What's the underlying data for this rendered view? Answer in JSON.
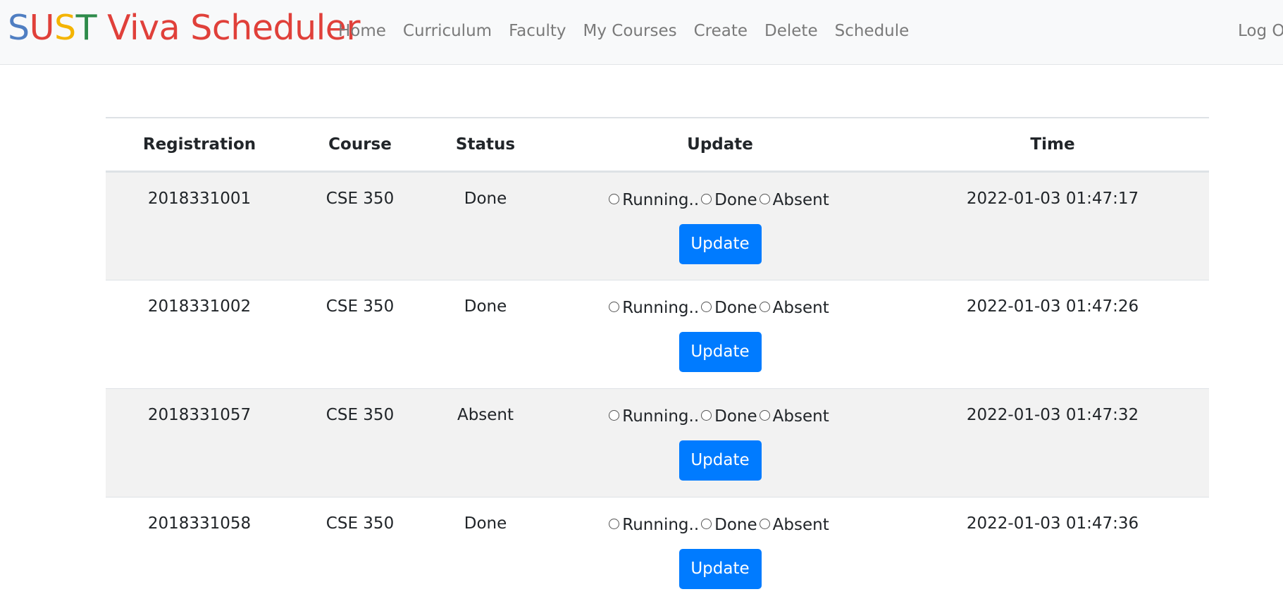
{
  "brand": {
    "letters": [
      {
        "char": "S",
        "color": "#4f7ec2"
      },
      {
        "char": "U",
        "color": "#e0403a"
      },
      {
        "char": "S",
        "color": "#f4b400"
      },
      {
        "char": "T",
        "color": "#2e8b4a"
      },
      {
        "char": " Viva Scheduler",
        "color": "#e0403a"
      }
    ]
  },
  "nav": {
    "links": [
      "Home",
      "Curriculum",
      "Faculty",
      "My Courses",
      "Create",
      "Delete",
      "Schedule"
    ],
    "logout": "Log Out"
  },
  "table": {
    "headers": [
      "Registration",
      "Course",
      "Status",
      "Update",
      "Time"
    ],
    "radio_options": [
      "Running..",
      "Done",
      "Absent"
    ],
    "button_label": "Update",
    "rows": [
      {
        "registration": "2018331001",
        "course": "CSE 350",
        "status": "Done",
        "time": "2022-01-03 01:47:17"
      },
      {
        "registration": "2018331002",
        "course": "CSE 350",
        "status": "Done",
        "time": "2022-01-03 01:47:26"
      },
      {
        "registration": "2018331057",
        "course": "CSE 350",
        "status": "Absent",
        "time": "2022-01-03 01:47:32"
      },
      {
        "registration": "2018331058",
        "course": "CSE 350",
        "status": "Done",
        "time": "2022-01-03 01:47:36"
      }
    ]
  },
  "colors": {
    "primary_button": "#007bff",
    "navbar_bg": "#f8f9fa",
    "stripe": "#f2f2f2"
  }
}
